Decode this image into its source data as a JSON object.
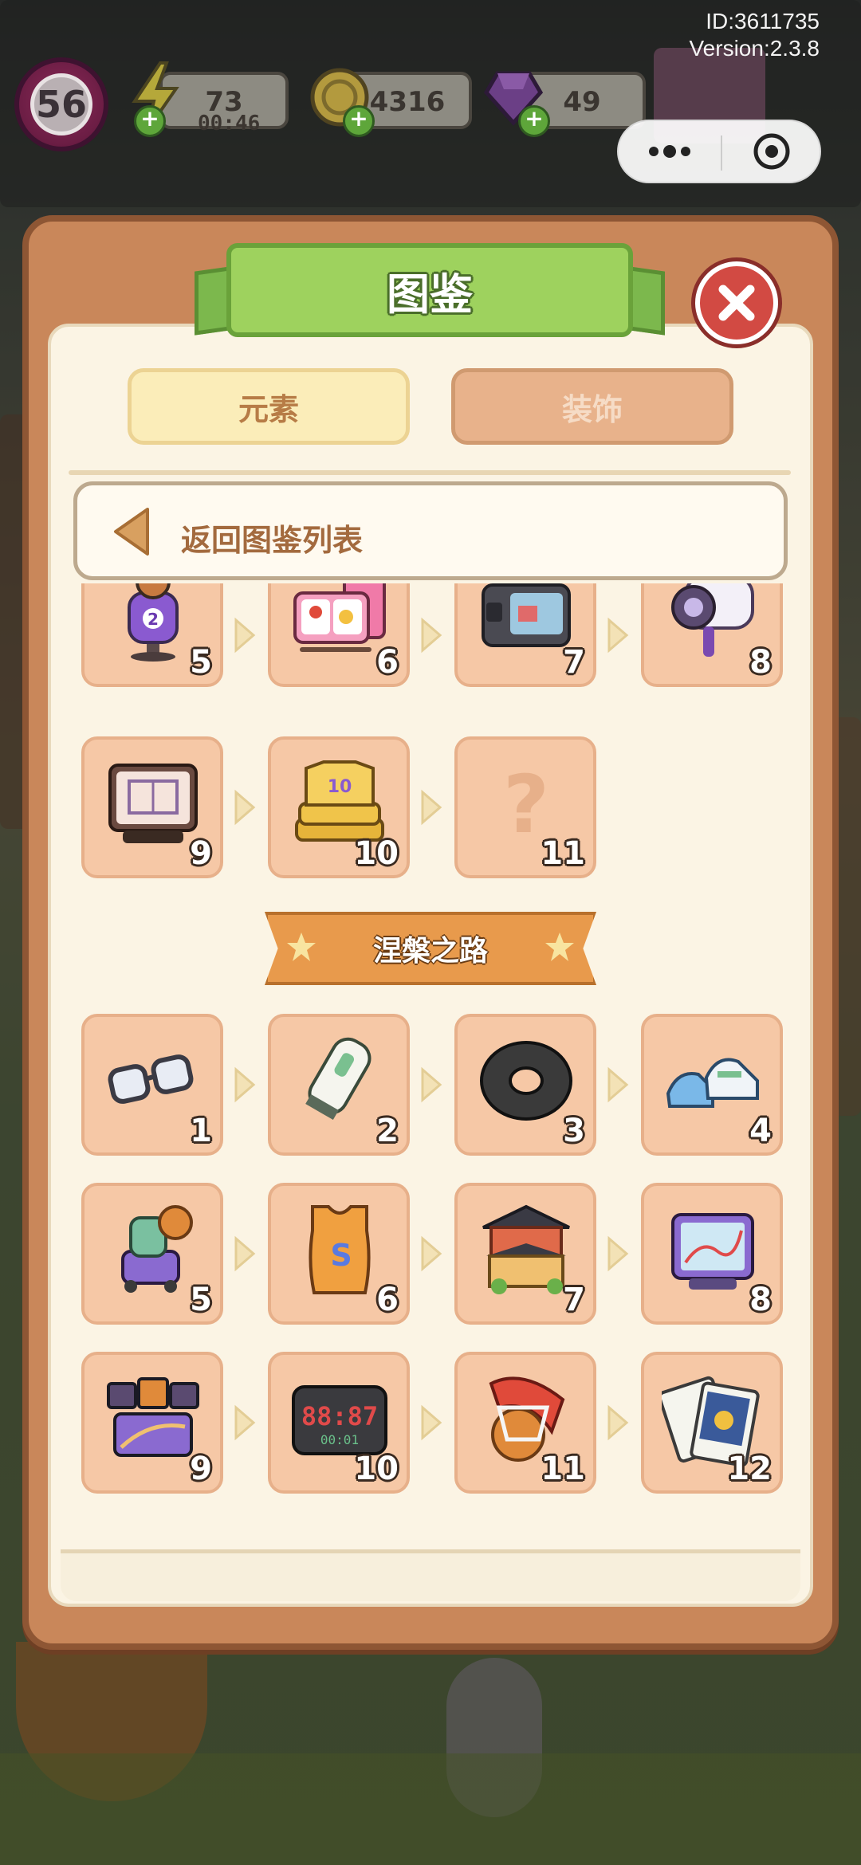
{
  "hud": {
    "id_label": "ID:3611735",
    "version_label": "Version:2.3.8",
    "level": "56",
    "energy": "73",
    "energy_timer": "00:46",
    "coins": "4316",
    "gems": "49"
  },
  "panel": {
    "title": "图鉴",
    "tabs": [
      {
        "label": "元素",
        "active": true
      },
      {
        "label": "装饰",
        "active": false
      }
    ],
    "back_label": "返回图鉴列表"
  },
  "chains": [
    {
      "section_title": "",
      "items": [
        {
          "num": "5",
          "icon": "robot-jersey-toy-icon"
        },
        {
          "num": "6",
          "icon": "bento-box-icon"
        },
        {
          "num": "7",
          "icon": "action-camera-icon"
        },
        {
          "num": "8",
          "icon": "video-camera-icon"
        },
        {
          "num": "9",
          "icon": "tactics-board-icon"
        },
        {
          "num": "10",
          "icon": "jersey-stack-icon"
        },
        {
          "num": "11",
          "icon": "question-mark-icon"
        }
      ]
    },
    {
      "section_title": "涅槃之路",
      "items": [
        {
          "num": "1",
          "icon": "glasses-icon"
        },
        {
          "num": "2",
          "icon": "hair-clipper-icon"
        },
        {
          "num": "3",
          "icon": "tire-icon"
        },
        {
          "num": "4",
          "icon": "sneakers-icon"
        },
        {
          "num": "5",
          "icon": "ball-machine-icon"
        },
        {
          "num": "6",
          "icon": "jersey-icon"
        },
        {
          "num": "7",
          "icon": "building-icon"
        },
        {
          "num": "8",
          "icon": "tablet-map-icon"
        },
        {
          "num": "9",
          "icon": "scoreboard-icon"
        },
        {
          "num": "10",
          "icon": "digital-clock-icon"
        },
        {
          "num": "11",
          "icon": "flaming-basketball-icon"
        },
        {
          "num": "12",
          "icon": "photo-cards-icon"
        }
      ]
    }
  ],
  "clock_display": {
    "big": "88:87",
    "small": "00:01"
  },
  "colors": {
    "panel_brown": "#c9875a",
    "card_peach": "#f6c8a6",
    "ribbon_green": "#9ed25e",
    "banner_orange": "#e89a4c",
    "close_red": "#d24a43"
  }
}
